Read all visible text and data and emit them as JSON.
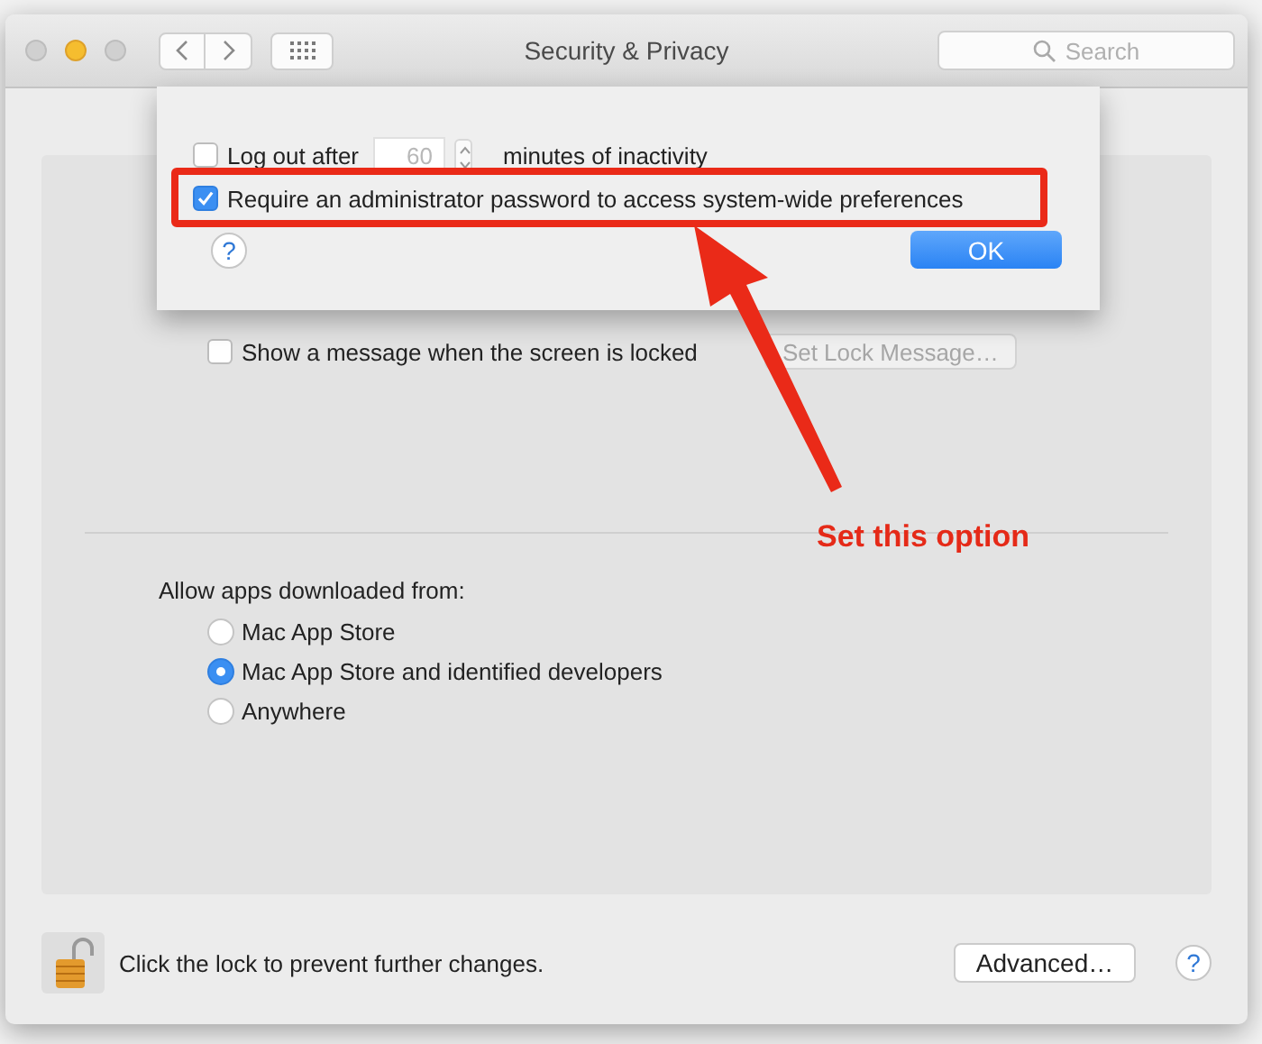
{
  "window": {
    "title": "Security & Privacy",
    "search": {
      "placeholder": "Search"
    }
  },
  "sheet": {
    "logout": {
      "label": "Log out after",
      "checked": false,
      "value": "60",
      "suffix": "minutes of inactivity"
    },
    "require_password": {
      "label": "Require an administrator password to access system-wide preferences",
      "checked": true
    },
    "help": "?",
    "ok_button": "OK"
  },
  "lock_message": {
    "label": "Show a message when the screen is locked",
    "checked": false,
    "button": "Set Lock Message…"
  },
  "downloads": {
    "label": "Allow apps downloaded from:",
    "options": [
      {
        "label": "Mac App Store",
        "selected": false
      },
      {
        "label": "Mac App Store and identified developers",
        "selected": true
      },
      {
        "label": "Anywhere",
        "selected": false
      }
    ]
  },
  "footer": {
    "lock_text": "Click the lock to prevent further changes.",
    "advanced_button": "Advanced…",
    "help": "?"
  },
  "annotation": {
    "label": "Set this option"
  }
}
